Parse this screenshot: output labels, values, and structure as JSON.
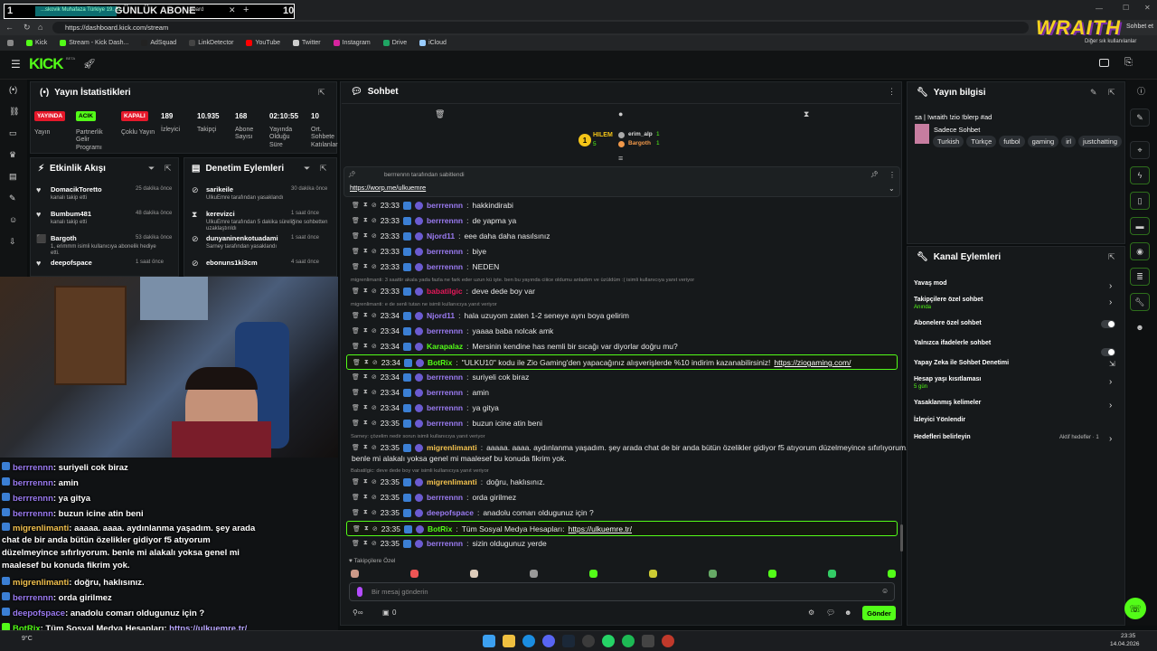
{
  "overlay_counter": {
    "left": "1",
    "title": "GÜNLÜK ABONE",
    "right": "10"
  },
  "browser": {
    "tab_partial": "...skovik Muhafaza Türkiye 19. Bl...",
    "tab_title": "...board",
    "url": "https://dashboard.kick.com/stream",
    "bookmarks": [
      "Kick",
      "Stream - Kick Dash...",
      "AdSquad",
      "LinkDetector",
      "YouTube",
      "Twitter",
      "Instagram",
      "Drive",
      "iCloud"
    ],
    "bookmarks_right": "Diğer sık kullanılanlar",
    "wraith_logo": "WRAITH",
    "wraith_sub": "Sohbet et"
  },
  "app": {
    "logo": "KICK",
    "logo_beta": "BETA"
  },
  "stats": {
    "title": "Yayın İstatistikleri",
    "badges": [
      {
        "badge": "YAYINDA",
        "label": "Yayın",
        "color": "#e5182a"
      },
      {
        "badge": "ACIK",
        "label": "Partnerlik Gelir Programı",
        "color": "#53fc18"
      },
      {
        "badge": "KAPALI",
        "label": "Çoklu Yayın",
        "color": "#e5182a"
      }
    ],
    "values": [
      {
        "value": "189",
        "label": "İzleyici"
      },
      {
        "value": "10.935",
        "label": "Takipçi"
      },
      {
        "value": "168",
        "label": "Abone Sayısı"
      },
      {
        "value": "02:10:55",
        "label": "Yayında Olduğu Süre"
      },
      {
        "value": "10",
        "label": "Ort. Sohbete Katılanlar"
      }
    ]
  },
  "activity": {
    "title": "Etkinlik Akışı",
    "items": [
      {
        "name": "DomacikToretto",
        "desc": "kanalı takip etti",
        "time": "25 dakika önce"
      },
      {
        "name": "Bumbum481",
        "desc": "kanalı takip etti",
        "time": "48 dakika önce"
      },
      {
        "name": "Bargoth",
        "desc": "1, erimmm isimli kullanıcıya abonelik hediye etti.",
        "time": "53 dakika önce"
      },
      {
        "name": "deepofspace",
        "desc": "",
        "time": "1 saat önce"
      }
    ]
  },
  "moderation": {
    "title": "Denetim Eylemleri",
    "items": [
      {
        "name": "sarikeile",
        "desc": "UlkuEmre tarafından yasaklandı",
        "time": "30 dakika önce"
      },
      {
        "name": "kerevizci",
        "desc": "UlkuEmre tarafından 5 dakika süreliğine sohbetten uzaklaştırıldı",
        "time": "1 saat önce"
      },
      {
        "name": "dunyaninenkotuadami",
        "desc": "Sarney tarafından yasaklandı",
        "time": "1 saat önce"
      },
      {
        "name": "ebonuns1ki3cm",
        "desc": "",
        "time": "4 saat önce"
      }
    ]
  },
  "chat": {
    "title": "Sohbet",
    "pinned_by": "berrrennn tarafından sabitlendi",
    "pinned_link": "https://worp.me/ulkuemre",
    "top_users": [
      {
        "name": "HILEM",
        "count": "5"
      },
      {
        "name": "erim_alp",
        "count": "1"
      },
      {
        "name": "Bargoth",
        "count": "1"
      }
    ],
    "partial": "çözelim nedir sorun",
    "messages": [
      {
        "time": "23:33",
        "user": "berrrennn",
        "text": "hakkindirabi",
        "color": "#9b7bf2"
      },
      {
        "time": "23:33",
        "user": "berrrennn",
        "text": "de yapma ya",
        "color": "#9b7bf2"
      },
      {
        "time": "23:33",
        "user": "Njord11",
        "text": "eee daha daha nasılsınız",
        "color": "#9b7bf2"
      },
      {
        "time": "23:33",
        "user": "berrrennn",
        "text": "biye",
        "color": "#9b7bf2"
      },
      {
        "time": "23:33",
        "user": "berrrennn",
        "text": "NEDEN",
        "color": "#9b7bf2"
      },
      {
        "reply": "migrenlimanti: 3 saattir akala yada fazla ne fark eder uzun kü işte. ben bu yayında ciiice oldumu anladım ve üzüldüm :( isimli kullanıcıya yanıt veriyor",
        "time": "23:33",
        "user": "babatilgic",
        "text": "deve dede boy var",
        "color": "#e5185a"
      },
      {
        "reply": "migrenlimanti: e de senli tutan ne isimli kullanıcıya yanıt veriyor",
        "time": "23:34",
        "user": "Njord11",
        "text": "hala uzuyom zaten 1-2 seneye aynı boya gelirim",
        "color": "#9b7bf2"
      },
      {
        "time": "23:34",
        "user": "berrrennn",
        "text": "yaaaa baba nolcak amk",
        "color": "#9b7bf2"
      },
      {
        "time": "23:34",
        "user": "Karapalaz",
        "text": "Mersinin kendine has nemli bir sıcağı var diyorlar doğru mu?",
        "color": "#53fc18"
      },
      {
        "time": "23:34",
        "user": "BotRix",
        "text": "\"ULKU10\" kodu ile Zio Gaming'den yapacağınız alışverişlerde %10 indirim kazanabilirsiniz!",
        "link": "https://ziogaming.com/",
        "color": "#53fc18",
        "hl": true
      },
      {
        "time": "23:34",
        "user": "berrrennn",
        "text": "suriyeli cok biraz",
        "color": "#9b7bf2"
      },
      {
        "time": "23:34",
        "user": "berrrennn",
        "text": "amin",
        "color": "#9b7bf2"
      },
      {
        "time": "23:34",
        "user": "berrrennn",
        "text": "ya gitya",
        "color": "#9b7bf2"
      },
      {
        "time": "23:35",
        "user": "berrrennn",
        "text": "buzun icine atin beni",
        "color": "#9b7bf2"
      },
      {
        "reply": "Sarney: çözelim nedir sorun isimli kullanıcıya yanıt veriyor",
        "time": "23:35",
        "user": "migrenlimanti",
        "text": "aaaaa. aaaa. aydınlanma yaşadım. şey arada chat de bir anda bütün özelikler gidiyor f5 atıyorum düzelmeyince sıfırlıyorum.",
        "text2": "benle mi alakalı yoksa genel mi maalesef bu konuda fikrim yok.",
        "color": "#f2c14e"
      },
      {
        "reply": "Babatilgic: deve dede boy var isimli kullanıcıya yanıt veriyor",
        "time": "23:35",
        "user": "migrenlimanti",
        "text": "doğru, haklısınız.",
        "color": "#f2c14e"
      },
      {
        "time": "23:35",
        "user": "berrrennn",
        "text": "orda girilmez",
        "color": "#9b7bf2"
      },
      {
        "time": "23:35",
        "user": "deepofspace",
        "text": "anadolu comarı oldugunuz için ?",
        "color": "#9b7bf2"
      },
      {
        "time": "23:35",
        "user": "BotRix",
        "text": "Tüm Sosyal Medya Hesapları:",
        "link": "https://ulkuemre.tr/",
        "color": "#53fc18",
        "hl": true
      },
      {
        "time": "23:35",
        "user": "berrrennn",
        "text": "sizin oldugunuz yerde",
        "color": "#9b7bf2"
      }
    ],
    "followers_only": "Takipçilere Özel",
    "input_placeholder": "Bir mesaj gönderin",
    "send": "Gönder",
    "count": "0"
  },
  "stream_info": {
    "title": "Yayın bilgisi",
    "stream_title": "sa | !wraith !zio !blerp #ad",
    "category": "Sadece Sohbet",
    "tags": [
      "Turkish",
      "Türkçe",
      "futbol",
      "gaming",
      "irl",
      "justchatting"
    ]
  },
  "channel_actions": {
    "title": "Kanal Eylemleri",
    "items": [
      {
        "label": "Yavaş mod",
        "sub": "",
        "kind": "arrow"
      },
      {
        "label": "Takipçilere özel sohbet",
        "sub": "Anında",
        "kind": "arrow"
      },
      {
        "label": "Abonelere özel sohbet",
        "sub": "",
        "kind": "toggle"
      },
      {
        "label": "Yalnızca ifadelerle sohbet",
        "sub": "",
        "kind": "toggle"
      },
      {
        "label": "Yapay Zeka ile Sohbet Denetimi",
        "sub": "",
        "kind": "ext"
      },
      {
        "label": "Hesap yaşı kısıtlaması",
        "sub": "5 gün",
        "kind": "arrow"
      },
      {
        "label": "Yasaklanmış kelimeler",
        "sub": "",
        "kind": "arrow"
      },
      {
        "label": "İzleyici Yönlendir",
        "sub": "",
        "kind": "none"
      },
      {
        "label": "Hedefleri belirleyin",
        "sub": "",
        "kind": "goal",
        "extra": "Aktif hedefler · 1"
      }
    ]
  },
  "overlay_chat": [
    {
      "user": "berrrennn",
      "text": ": suriyeli cok biraz"
    },
    {
      "user": "berrrennn",
      "text": ": amin"
    },
    {
      "user": "berrrennn",
      "text": ": ya gitya"
    },
    {
      "user": "berrrennn",
      "text": ": buzun icine atin beni"
    },
    {
      "user": "migrenlimanti",
      "text": ": aaaaa. aaaa. aydınlanma yaşadım. şey arada"
    },
    {
      "user": "",
      "text": "chat de bir anda bütün özelikler gidiyor f5 atıyorum"
    },
    {
      "user": "",
      "text": "düzelmeyince sıfırlıyorum. benle mi alakalı yoksa genel mi"
    },
    {
      "user": "",
      "text": "maalesef bu konuda fikrim yok."
    },
    {
      "user": "migrenlimanti",
      "text": ": doğru, haklısınız."
    },
    {
      "user": "berrrennn",
      "text": ": orda girilmez"
    },
    {
      "user": "deepofspace",
      "text": ": anadolu comarı oldugunuz için ?"
    },
    {
      "user": "BotRix",
      "text": ": Tüm Sosyal Medya Hesapları: ",
      "link": "https://ulkuemre.tr/"
    },
    {
      "user": "berrrennn",
      "text": ": sizin oldugunuz yerde"
    }
  ],
  "taskbar": {
    "weather": "9°C",
    "time": "23:35",
    "date": "14.04.2026"
  },
  "colors": {
    "accent": "#53fc18",
    "bg": "#0b0e0f",
    "panel": "#16191b",
    "red": "#e5182a"
  }
}
